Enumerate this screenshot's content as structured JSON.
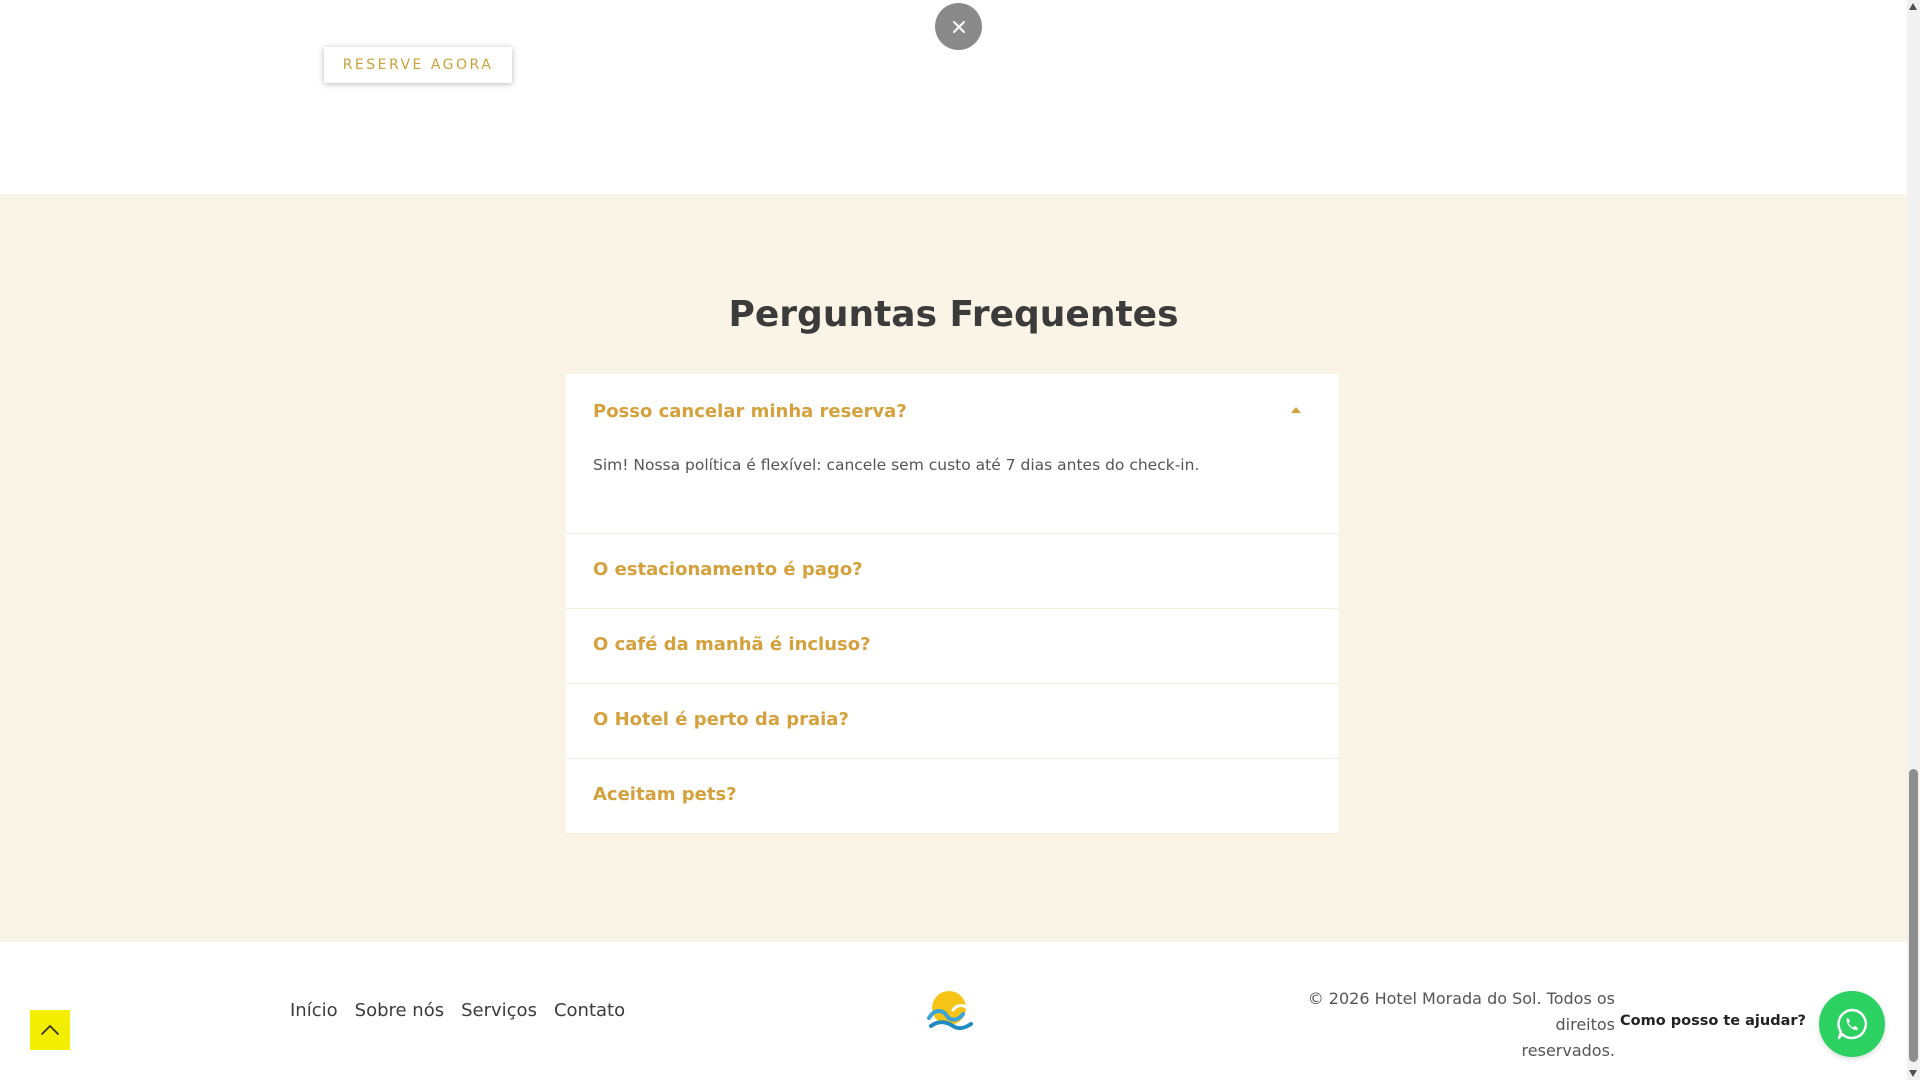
{
  "top": {
    "reserve_button": "RESERVE AGORA",
    "close_icon": "close-icon"
  },
  "faq": {
    "title": "Perguntas Frequentes",
    "items": [
      {
        "question": "Posso cancelar minha reserva?",
        "answer": "Sim! Nossa política é flexível: cancele sem custo até 7 dias antes do check-in.",
        "expanded": true
      },
      {
        "question": "O estacionamento é pago?",
        "expanded": false
      },
      {
        "question": "O café da manhã é incluso?",
        "expanded": false
      },
      {
        "question": "O Hotel é perto da praia?",
        "expanded": false
      },
      {
        "question": "Aceitam pets?",
        "expanded": false
      }
    ]
  },
  "footer": {
    "nav": [
      "Início",
      "Sobre nós",
      "Serviços",
      "Contato"
    ],
    "copyright_line1": "© 2026 Hotel Morada do Sol. Todos os direitos",
    "copyright_line2": "reservados.",
    "whatsapp_label": "Como posso te ajudar?",
    "scroll_top_icon": "chevron-up-icon",
    "whatsapp_icon": "whatsapp-icon",
    "logo_icon": "sun-wave-logo"
  },
  "colors": {
    "accent_gold": "#d4a13d",
    "section_bg": "#f9f4e5",
    "whatsapp_green": "#2bd262",
    "scroll_top_yellow": "#f4ee00"
  }
}
